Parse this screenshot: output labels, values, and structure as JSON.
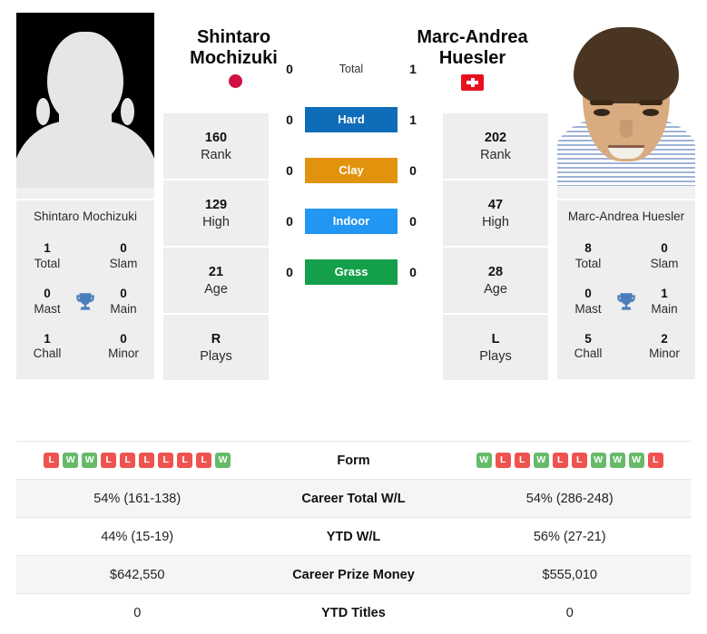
{
  "players": {
    "left": {
      "name_line1": "Shintaro",
      "name_line2": "Mochizuki",
      "full_name": "Shintaro Mochizuki",
      "flag": "japan-flag",
      "photo": "placeholder-silhouette",
      "stats": [
        {
          "value": "160",
          "label": "Rank"
        },
        {
          "value": "129",
          "label": "High"
        },
        {
          "value": "21",
          "label": "Age"
        },
        {
          "value": "R",
          "label": "Plays"
        }
      ],
      "titles": [
        {
          "value": "1",
          "label": "Total"
        },
        {
          "value": "0",
          "label": "Slam"
        },
        {
          "value": "0",
          "label": "Mast"
        },
        {
          "value": "0",
          "label": "Main"
        },
        {
          "value": "1",
          "label": "Chall"
        },
        {
          "value": "0",
          "label": "Minor"
        }
      ],
      "h2h": {
        "total": "0",
        "hard": "0",
        "clay": "0",
        "indoor": "0",
        "grass": "0"
      },
      "form": [
        "L",
        "W",
        "W",
        "L",
        "L",
        "L",
        "L",
        "L",
        "L",
        "W"
      ],
      "career_total_wl": "54% (161-138)",
      "ytd_wl": "44% (15-19)",
      "career_prize_money": "$642,550",
      "ytd_titles": "0"
    },
    "right": {
      "name_line1": "Marc-Andrea",
      "name_line2": "Huesler",
      "full_name": "Marc-Andrea Huesler",
      "flag": "switzerland-flag",
      "photo": "player-portrait",
      "stats": [
        {
          "value": "202",
          "label": "Rank"
        },
        {
          "value": "47",
          "label": "High"
        },
        {
          "value": "28",
          "label": "Age"
        },
        {
          "value": "L",
          "label": "Plays"
        }
      ],
      "titles": [
        {
          "value": "8",
          "label": "Total"
        },
        {
          "value": "0",
          "label": "Slam"
        },
        {
          "value": "0",
          "label": "Mast"
        },
        {
          "value": "1",
          "label": "Main"
        },
        {
          "value": "5",
          "label": "Chall"
        },
        {
          "value": "2",
          "label": "Minor"
        }
      ],
      "h2h": {
        "total": "1",
        "hard": "1",
        "clay": "0",
        "indoor": "0",
        "grass": "0"
      },
      "form": [
        "W",
        "L",
        "L",
        "W",
        "L",
        "L",
        "W",
        "W",
        "W",
        "L"
      ],
      "career_total_wl": "54% (286-248)",
      "ytd_wl": "56% (27-21)",
      "career_prize_money": "$555,010",
      "ytd_titles": "0"
    }
  },
  "h2h_rows": [
    {
      "key": "total",
      "label": "Total",
      "color": "none"
    },
    {
      "key": "hard",
      "label": "Hard",
      "color": "#0e6cb8"
    },
    {
      "key": "clay",
      "label": "Clay",
      "color": "#e2930d"
    },
    {
      "key": "indoor",
      "label": "Indoor",
      "color": "#2196f3"
    },
    {
      "key": "grass",
      "label": "Grass",
      "color": "#14a04a"
    }
  ],
  "comparison_rows": [
    {
      "label": "Form"
    },
    {
      "label": "Career Total W/L"
    },
    {
      "label": "YTD W/L"
    },
    {
      "label": "Career Prize Money"
    },
    {
      "label": "YTD Titles"
    }
  ],
  "colors": {
    "hard": "#0e6cb8",
    "clay": "#e2930d",
    "indoor": "#2196f3",
    "grass": "#14a04a",
    "win": "#66bb6a",
    "loss": "#ef5350",
    "card_bg": "#eeeeee",
    "row_alt_bg": "#f5f5f5",
    "trophy": "#4a7ebb",
    "japan_red": "#cf1040",
    "swiss_red": "#e8101f"
  }
}
